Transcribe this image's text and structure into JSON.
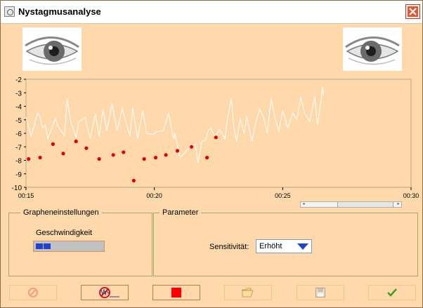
{
  "window": {
    "title": "Nystagmusanalyse"
  },
  "chart_data": {
    "type": "line",
    "title": "",
    "xlabel": "",
    "ylabel": "",
    "xlim": [
      "00:15",
      "00:30"
    ],
    "ylim": [
      -10,
      -2
    ],
    "x_ticks": [
      "00:15",
      "00:20",
      "00:25",
      "00:30"
    ],
    "y_ticks": [
      "-2",
      "-3",
      "-4",
      "-5",
      "-6",
      "-7",
      "-8",
      "-9",
      "-10"
    ],
    "grid": false,
    "series": [
      {
        "style": "line",
        "color": "#ffffff",
        "points": [
          [
            15.0,
            -4.8
          ],
          [
            15.2,
            -6.2
          ],
          [
            15.45,
            -4.5
          ],
          [
            15.55,
            -4.8
          ],
          [
            15.65,
            -5.6
          ],
          [
            15.75,
            -5.4
          ],
          [
            15.85,
            -6.4
          ],
          [
            16.15,
            -4.9
          ],
          [
            16.25,
            -5.5
          ],
          [
            16.5,
            -6.2
          ],
          [
            16.6,
            -3.4
          ],
          [
            16.75,
            -5.2
          ],
          [
            16.95,
            -6.3
          ],
          [
            17.05,
            -5.2
          ],
          [
            17.3,
            -4.8
          ],
          [
            17.5,
            -6.4
          ],
          [
            17.7,
            -4.6
          ],
          [
            17.85,
            -6.2
          ],
          [
            18.0,
            -4.2
          ],
          [
            18.15,
            -5.8
          ],
          [
            18.35,
            -3.8
          ],
          [
            18.55,
            -5.8
          ],
          [
            18.75,
            -4.2
          ],
          [
            19.05,
            -6.2
          ],
          [
            19.15,
            -4.1
          ],
          [
            19.3,
            -5.8
          ],
          [
            19.35,
            -6.4
          ],
          [
            19.55,
            -4.3
          ],
          [
            19.7,
            -6.0
          ],
          [
            19.95,
            -6.1
          ],
          [
            20.05,
            -5.9
          ],
          [
            20.35,
            -5.8
          ],
          [
            20.55,
            -4.5
          ],
          [
            20.75,
            -6.4
          ],
          [
            20.8,
            -6.0
          ],
          [
            21.0,
            -7.8
          ],
          [
            21.3,
            -7.2
          ],
          [
            21.6,
            -6.8
          ],
          [
            21.7,
            -8.2
          ],
          [
            21.85,
            -6.6
          ],
          [
            22.0,
            -6.5
          ],
          [
            22.1,
            -5.8
          ],
          [
            22.2,
            -5.6
          ],
          [
            22.35,
            -6.3
          ],
          [
            22.55,
            -5.7
          ],
          [
            22.75,
            -6.4
          ],
          [
            22.85,
            -4.9
          ],
          [
            23.0,
            -3.4
          ],
          [
            23.1,
            -5.6
          ],
          [
            23.2,
            -6.6
          ],
          [
            23.35,
            -4.9
          ],
          [
            23.5,
            -6.0
          ],
          [
            23.6,
            -4.8
          ],
          [
            23.8,
            -6.6
          ],
          [
            23.95,
            -5.2
          ],
          [
            24.1,
            -4.2
          ],
          [
            24.25,
            -4.8
          ],
          [
            24.4,
            -6.0
          ],
          [
            24.55,
            -3.4
          ],
          [
            24.7,
            -4.9
          ],
          [
            24.85,
            -5.9
          ],
          [
            25.0,
            -4.3
          ],
          [
            25.2,
            -5.6
          ],
          [
            25.4,
            -4.5
          ],
          [
            25.55,
            -5.0
          ],
          [
            25.7,
            -3.3
          ],
          [
            25.85,
            -4.5
          ],
          [
            26.05,
            -5.1
          ],
          [
            26.25,
            -3.3
          ],
          [
            26.35,
            -5.4
          ],
          [
            26.5,
            -3.5
          ],
          [
            26.55,
            -2.6
          ],
          [
            26.6,
            -3.2
          ]
        ]
      },
      {
        "style": "scatter",
        "color": "#e00000",
        "points": [
          [
            15.1,
            -7.9
          ],
          [
            15.55,
            -7.8
          ],
          [
            16.05,
            -6.8
          ],
          [
            16.45,
            -7.5
          ],
          [
            16.95,
            -6.6
          ],
          [
            17.35,
            -7.1
          ],
          [
            17.85,
            -7.9
          ],
          [
            18.4,
            -7.6
          ],
          [
            18.8,
            -7.4
          ],
          [
            19.2,
            -9.5
          ],
          [
            19.6,
            -7.9
          ],
          [
            20.05,
            -7.8
          ],
          [
            20.45,
            -7.6
          ],
          [
            20.9,
            -7.3
          ],
          [
            21.45,
            -7.0
          ],
          [
            22.05,
            -7.8
          ],
          [
            22.4,
            -6.3
          ]
        ]
      }
    ]
  },
  "groups": {
    "graph": {
      "title": "Grapheneinstellungen",
      "speed_label": "Geschwindigkeit",
      "speed_level": 0.25
    },
    "params": {
      "title": "Parameter",
      "sensitivity_label": "Sensitivität:",
      "sensitivity_value": "Erhöht"
    }
  },
  "toolbar": [
    "cancel-icon",
    "no-graph-icon",
    "stop-icon",
    "open-folder-icon",
    "save-icon",
    "check-icon"
  ],
  "colors": {
    "background": "#ffd9ac",
    "accent": "#1f43cf",
    "stop": "#ff0000",
    "check": "#40a020"
  }
}
